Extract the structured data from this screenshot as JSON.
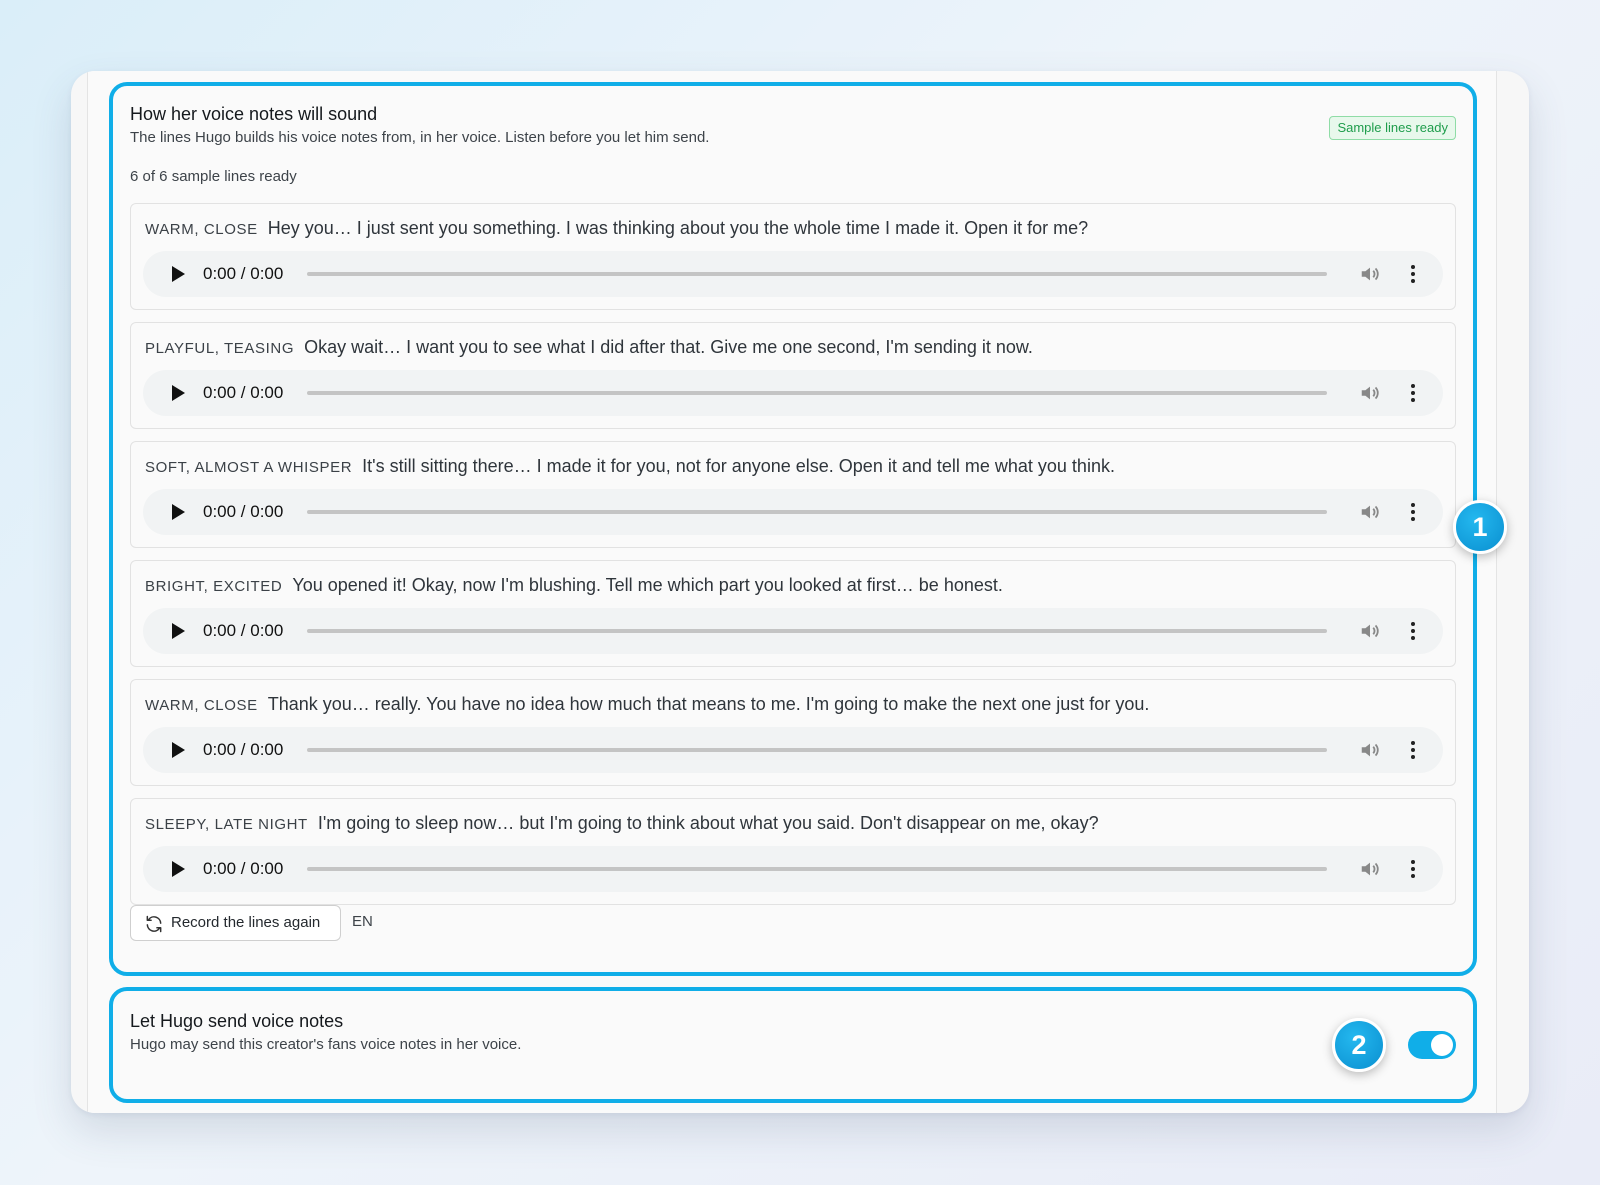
{
  "voice_section": {
    "title": "How her voice notes will sound",
    "description": "The lines Hugo builds his voice notes from, in her voice. Listen before you let him send.",
    "status_badge": "Sample lines ready",
    "ready_count": "6 of 6 sample lines ready",
    "samples": [
      {
        "tone": "WARM, CLOSE",
        "text": "Hey you… I just sent you something. I was thinking about you the whole time I made it. Open it for me?",
        "time": "0:00 / 0:00"
      },
      {
        "tone": "PLAYFUL, TEASING",
        "text": "Okay wait… I want you to see what I did after that. Give me one second, I'm sending it now.",
        "time": "0:00 / 0:00"
      },
      {
        "tone": "SOFT, ALMOST A WHISPER",
        "text": "It's still sitting there… I made it for you, not for anyone else. Open it and tell me what you think.",
        "time": "0:00 / 0:00"
      },
      {
        "tone": "BRIGHT, EXCITED",
        "text": "You opened it! Okay, now I'm blushing. Tell me which part you looked at first… be honest.",
        "time": "0:00 / 0:00"
      },
      {
        "tone": "WARM, CLOSE",
        "text": "Thank you… really. You have no idea how much that means to me. I'm going to make the next one just for you.",
        "time": "0:00 / 0:00"
      },
      {
        "tone": "SLEEPY, LATE NIGHT",
        "text": "I'm going to sleep now… but I'm going to think about what you said. Don't disappear on me, okay?",
        "time": "0:00 / 0:00"
      }
    ],
    "record_again_label": "Record the lines again",
    "language": "EN"
  },
  "send_section": {
    "title": "Let Hugo send voice notes",
    "description": "Hugo may send this creator's fans voice notes in her voice.",
    "toggle_on": true
  },
  "callouts": [
    "1",
    "2"
  ],
  "colors": {
    "accent": "#10aee8",
    "badge_green": "#1f9d4c"
  },
  "icons": [
    "play-icon",
    "volume-icon",
    "more-vertical-icon",
    "refresh-icon"
  ]
}
